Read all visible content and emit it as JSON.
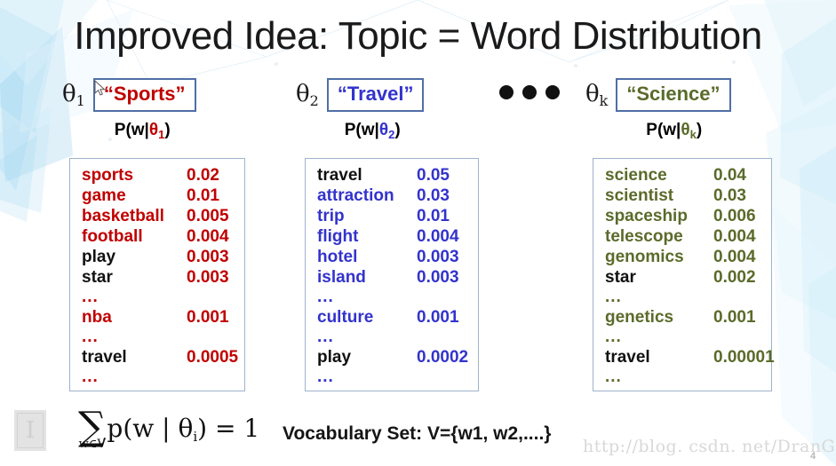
{
  "slide": {
    "title": "Improved Idea: Topic = Word Distribution",
    "number": "4",
    "watermark": "http://blog. csdn. net/DranGoo",
    "logo_glyph": "I"
  },
  "colors": {
    "sports_red": "#c00000",
    "travel_blue": "#3333cc",
    "science_green": "#5a6b2a",
    "black": "#111111",
    "box_border": "#9fb3cc",
    "name_box_border": "#4f6fa5"
  },
  "gap_dots": [
    "dot",
    "dot",
    "dot"
  ],
  "topics": [
    {
      "theta": "θ",
      "theta_sub": "1",
      "name": "“Sports”",
      "name_color": "#c00000",
      "pw_prefix": "P(w|",
      "pw_theta": "θ",
      "pw_sub": "1",
      "pw_suffix": ")",
      "rows": [
        {
          "word": "sports",
          "prob": "0.02",
          "word_color": "#c00000",
          "prob_color": "#c00000"
        },
        {
          "word": "game",
          "prob": "0.01",
          "word_color": "#c00000",
          "prob_color": "#c00000"
        },
        {
          "word": "basketball",
          "prob": "0.005",
          "word_color": "#c00000",
          "prob_color": "#c00000"
        },
        {
          "word": "football",
          "prob": "0.004",
          "word_color": "#c00000",
          "prob_color": "#c00000"
        },
        {
          "word": "play",
          "prob": "0.003",
          "word_color": "#111111",
          "prob_color": "#c00000"
        },
        {
          "word": "star",
          "prob": "0.003",
          "word_color": "#111111",
          "prob_color": "#c00000"
        },
        {
          "word": "...",
          "prob": "",
          "word_color": "#c00000",
          "prob_color": "#c00000"
        },
        {
          "word": "nba",
          "prob": "0.001",
          "word_color": "#c00000",
          "prob_color": "#c00000"
        },
        {
          "word": "...",
          "prob": "",
          "word_color": "#c00000",
          "prob_color": "#c00000"
        },
        {
          "word": "travel",
          "prob": "0.0005",
          "word_color": "#111111",
          "prob_color": "#c00000"
        },
        {
          "word": "...",
          "prob": "",
          "word_color": "#c00000",
          "prob_color": "#c00000"
        }
      ]
    },
    {
      "theta": "θ",
      "theta_sub": "2",
      "name": "“Travel”",
      "name_color": "#3333cc",
      "pw_prefix": "P(w|",
      "pw_theta": "θ",
      "pw_sub": "2",
      "pw_suffix": ")",
      "rows": [
        {
          "word": "travel",
          "prob": "0.05",
          "word_color": "#111111",
          "prob_color": "#3333cc"
        },
        {
          "word": "attraction",
          "prob": "0.03",
          "word_color": "#3333cc",
          "prob_color": "#3333cc"
        },
        {
          "word": "trip",
          "prob": "0.01",
          "word_color": "#3333cc",
          "prob_color": "#3333cc"
        },
        {
          "word": "flight",
          "prob": "0.004",
          "word_color": "#3333cc",
          "prob_color": "#3333cc"
        },
        {
          "word": "hotel",
          "prob": "0.003",
          "word_color": "#3333cc",
          "prob_color": "#3333cc"
        },
        {
          "word": "island",
          "prob": "0.003",
          "word_color": "#3333cc",
          "prob_color": "#3333cc"
        },
        {
          "word": "...",
          "prob": "",
          "word_color": "#3333cc",
          "prob_color": "#3333cc"
        },
        {
          "word": "culture",
          "prob": "0.001",
          "word_color": "#3333cc",
          "prob_color": "#3333cc"
        },
        {
          "word": "...",
          "prob": "",
          "word_color": "#3333cc",
          "prob_color": "#3333cc"
        },
        {
          "word": "play",
          "prob": "0.0002",
          "word_color": "#111111",
          "prob_color": "#3333cc"
        },
        {
          "word": "...",
          "prob": "",
          "word_color": "#3333cc",
          "prob_color": "#3333cc"
        }
      ]
    },
    {
      "theta": "θ",
      "theta_sub": "k",
      "name": "“Science”",
      "name_color": "#5a6b2a",
      "pw_prefix": "P(w|",
      "pw_theta": "θ",
      "pw_sub": "k",
      "pw_suffix": ")",
      "rows": [
        {
          "word": "science",
          "prob": "0.04",
          "word_color": "#5a6b2a",
          "prob_color": "#5a6b2a"
        },
        {
          "word": "scientist",
          "prob": "0.03",
          "word_color": "#5a6b2a",
          "prob_color": "#5a6b2a"
        },
        {
          "word": "spaceship",
          "prob": "0.006",
          "word_color": "#5a6b2a",
          "prob_color": "#5a6b2a"
        },
        {
          "word": "telescope",
          "prob": "0.004",
          "word_color": "#5a6b2a",
          "prob_color": "#5a6b2a"
        },
        {
          "word": "genomics",
          "prob": "0.004",
          "word_color": "#5a6b2a",
          "prob_color": "#5a6b2a"
        },
        {
          "word": "star",
          "prob": "0.002",
          "word_color": "#111111",
          "prob_color": "#5a6b2a"
        },
        {
          "word": "...",
          "prob": "",
          "word_color": "#5a6b2a",
          "prob_color": "#5a6b2a"
        },
        {
          "word": "genetics",
          "prob": "0.001",
          "word_color": "#5a6b2a",
          "prob_color": "#5a6b2a"
        },
        {
          "word": "...",
          "prob": "",
          "word_color": "#5a6b2a",
          "prob_color": "#5a6b2a"
        },
        {
          "word": "travel",
          "prob": "0.00001",
          "word_color": "#111111",
          "prob_color": "#5a6b2a"
        },
        {
          "word": "...",
          "prob": "",
          "word_color": "#5a6b2a",
          "prob_color": "#5a6b2a"
        }
      ]
    }
  ],
  "footer": {
    "sum_sigma": "∑",
    "sum_subscript": "w∈V",
    "sum_expr_prefix": "p(w | ",
    "sum_expr_theta": "θ",
    "sum_expr_sub": "i",
    "sum_expr_suffix": ") = 1",
    "vocabulary": "Vocabulary Set: V={w1, w2,....}"
  }
}
